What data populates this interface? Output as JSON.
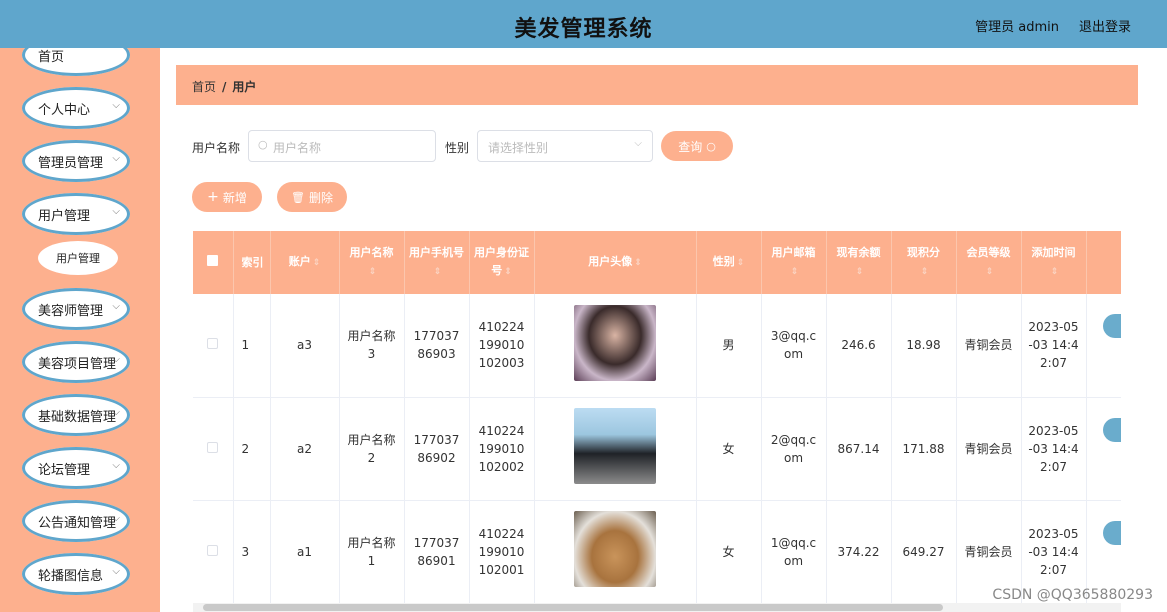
{
  "header": {
    "title": "美发管理系统",
    "user": "管理员 admin",
    "logout": "退出登录"
  },
  "sidebar": {
    "items": [
      {
        "label": "首页",
        "has_chevron": false
      },
      {
        "label": "个人中心",
        "has_chevron": true
      },
      {
        "label": "管理员管理",
        "has_chevron": true
      },
      {
        "label": "用户管理",
        "has_chevron": true
      },
      {
        "label": "美容师管理",
        "has_chevron": true
      },
      {
        "label": "美容项目管理",
        "has_chevron": true
      },
      {
        "label": "基础数据管理",
        "has_chevron": true
      },
      {
        "label": "论坛管理",
        "has_chevron": true
      },
      {
        "label": "公告通知管理",
        "has_chevron": true
      },
      {
        "label": "轮播图信息",
        "has_chevron": true
      }
    ],
    "sub_item": "用户管理"
  },
  "breadcrumb": {
    "home": "首页",
    "sep": "/",
    "current": "用户"
  },
  "search": {
    "name_label": "用户名称",
    "name_placeholder": "用户名称",
    "gender_label": "性别",
    "gender_placeholder": "请选择性别",
    "query_label": "查询"
  },
  "actions": {
    "add_label": "新增",
    "delete_label": "删除"
  },
  "table": {
    "columns": [
      "索引",
      "账户",
      "用户名称",
      "用户手机号",
      "用户身份证号",
      "用户头像",
      "性别",
      "用户邮箱",
      "现有余额",
      "现积分",
      "会员等级",
      "添加时间"
    ],
    "rows": [
      {
        "index": "1",
        "account": "a3",
        "name": "用户名称3",
        "phone": "17703786903",
        "idcard": "410224199010102003",
        "gender": "男",
        "email": "3@qq.com",
        "balance": "246.6",
        "points": "18.98",
        "level": "青铜会员",
        "time": "2023-05-03 14:42:07"
      },
      {
        "index": "2",
        "account": "a2",
        "name": "用户名称2",
        "phone": "17703786902",
        "idcard": "410224199010102002",
        "gender": "女",
        "email": "2@qq.com",
        "balance": "867.14",
        "points": "171.88",
        "level": "青铜会员",
        "time": "2023-05-03 14:42:07"
      },
      {
        "index": "3",
        "account": "a1",
        "name": "用户名称1",
        "phone": "17703786901",
        "idcard": "410224199010102001",
        "gender": "女",
        "email": "1@qq.com",
        "balance": "374.22",
        "points": "649.27",
        "level": "青铜会员",
        "time": "2023-05-03 14:42:07"
      }
    ]
  },
  "watermark": "CSDN @QQ365880293",
  "colors": {
    "header": "#5fa6cc",
    "accent": "#fdb08e"
  }
}
